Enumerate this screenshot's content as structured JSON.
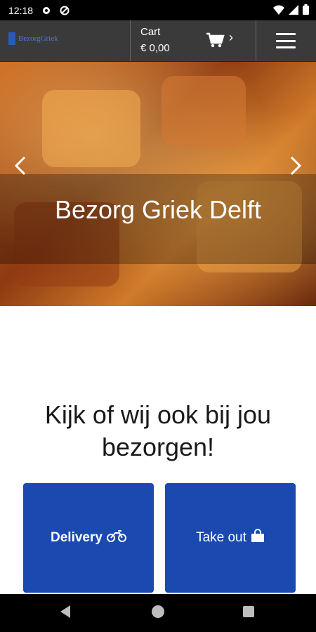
{
  "status_bar": {
    "time": "12:18"
  },
  "header": {
    "logo_text": "BezorgGriek",
    "cart_label": "Cart",
    "cart_amount": "€ 0,00"
  },
  "hero": {
    "title": "Bezorg Griek Delft"
  },
  "main": {
    "heading": "Kijk of wij ook bij jou bezorgen!",
    "delivery_label": "Delivery",
    "takeout_label": "Take out"
  },
  "colors": {
    "header_bg": "#3a3a3a",
    "tile_blue": "#1a4ab0"
  }
}
